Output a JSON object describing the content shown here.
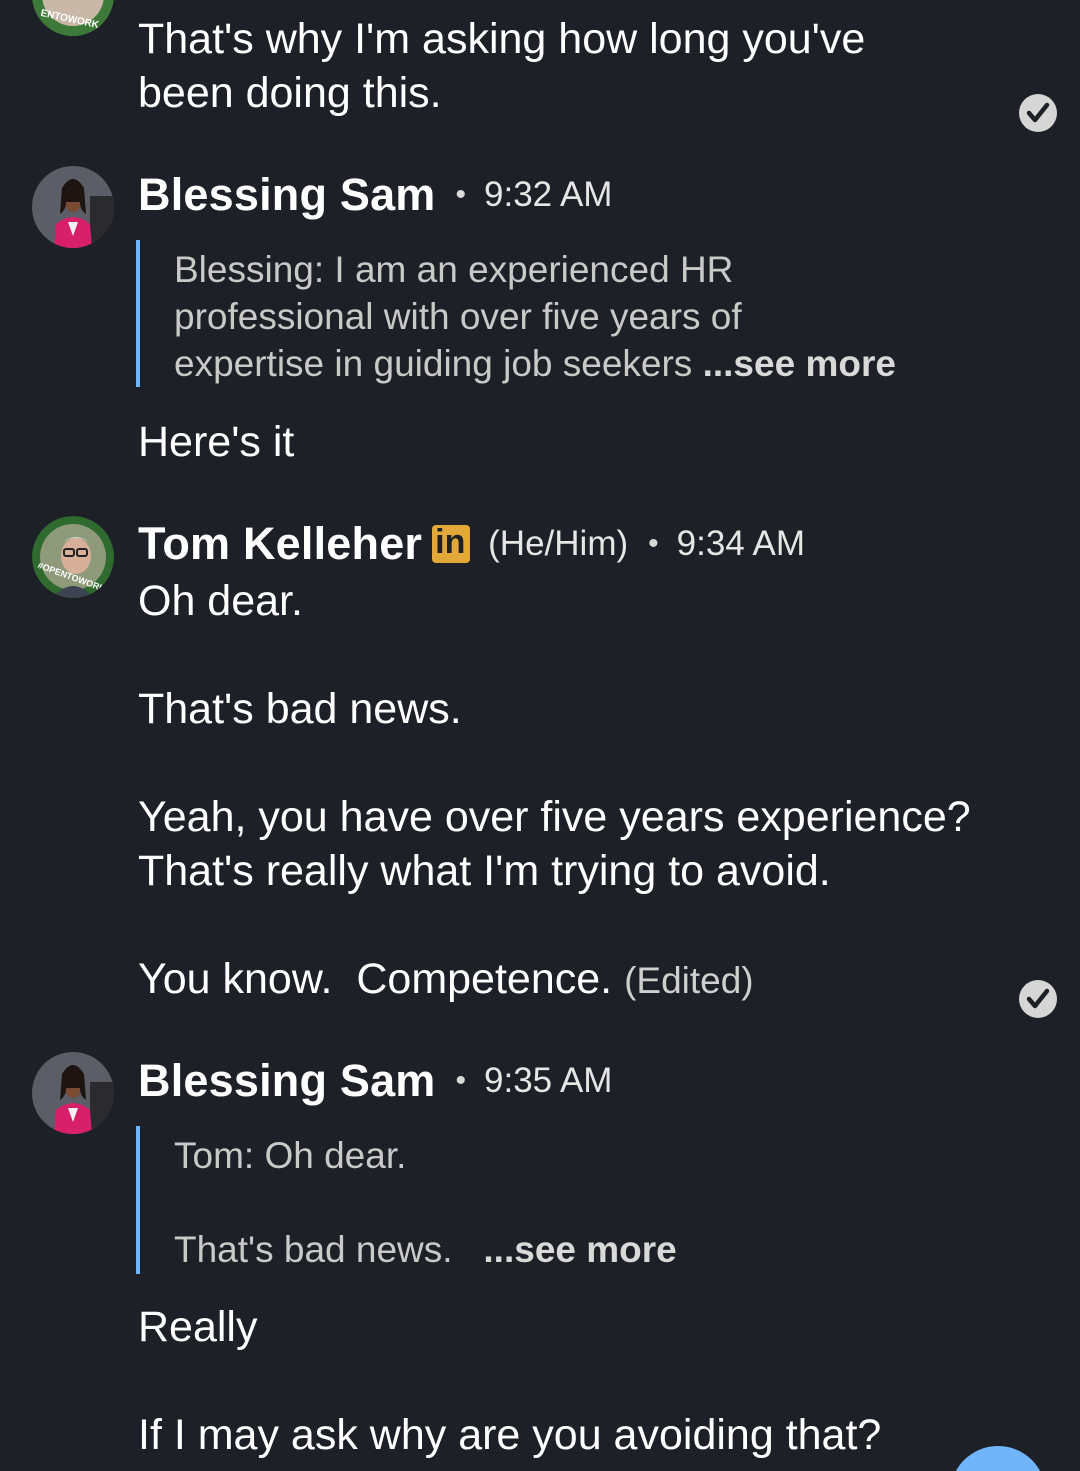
{
  "messages": {
    "m0": {
      "lines": [
        "That's why I'm asking how long you've",
        "been doing this."
      ]
    },
    "blessing1": {
      "name": "Blessing Sam",
      "time": "9:32 AM",
      "quote_lines": [
        "Blessing: I am an experienced HR",
        "professional with over five years of",
        "expertise in guiding job seekers"
      ],
      "see_more": "...see more",
      "text": "Here's it"
    },
    "tom": {
      "name": "Tom Kelleher",
      "badge": "in",
      "pronoun": "(He/Him)",
      "time": "9:34 AM",
      "p1": "Oh dear.",
      "p2": "That's bad news.",
      "p3_lines": [
        "Yeah, you have over five years experience?",
        "That's really what I'm trying to avoid."
      ],
      "p4": "You know.  Competence.",
      "edited": "(Edited)",
      "avatar_ring_text": "#OPENTOWORK"
    },
    "blessing2": {
      "name": "Blessing Sam",
      "time": "9:35 AM",
      "quote_line1": "Tom: Oh dear.",
      "quote_line2": "That's bad news.",
      "see_more": "...see more",
      "p1": "Really",
      "p2": "If I may ask why are you avoiding that?"
    },
    "top_avatar_ring_text": "ENTOWORK"
  },
  "colors": {
    "background": "#1d2026",
    "quote_bar": "#70b5f9",
    "linkedin_badge": "#e3a83a",
    "opentowork_ring": "#3d7a3a",
    "fab": "#70b5f9"
  },
  "icons": {
    "read_receipt": "check-circle-icon",
    "linkedin": "linkedin-badge-icon"
  }
}
